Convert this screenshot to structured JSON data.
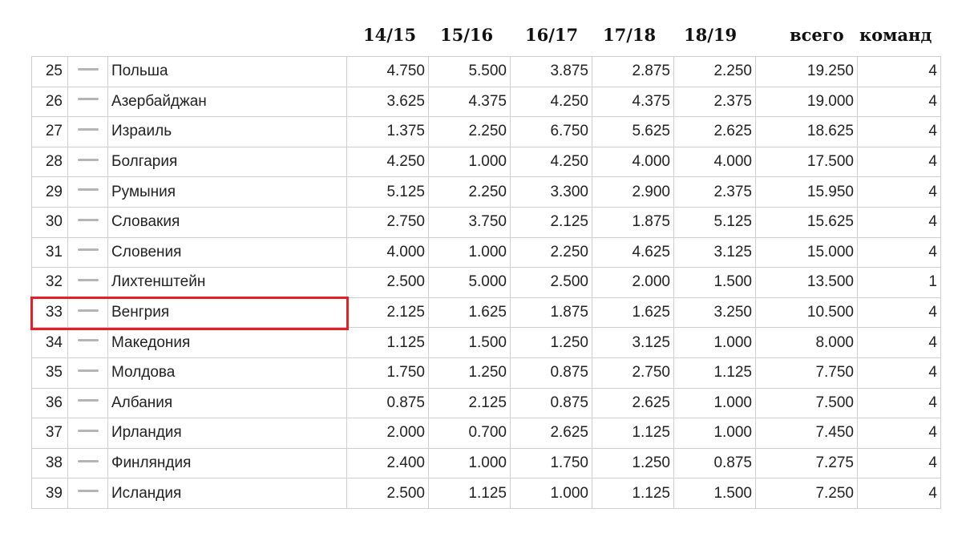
{
  "header": {
    "seasons": [
      "14/15",
      "15/16",
      "16/17",
      "17/18",
      "18/19"
    ],
    "total_label": "всего",
    "teams_label": "команд"
  },
  "rows": [
    {
      "rank": "25",
      "country": "Польша",
      "s1": "4.750",
      "s2": "5.500",
      "s3": "3.875",
      "s4": "2.875",
      "s5": "2.250",
      "total": "19.250",
      "teams": "4"
    },
    {
      "rank": "26",
      "country": "Азербайджан",
      "s1": "3.625",
      "s2": "4.375",
      "s3": "4.250",
      "s4": "4.375",
      "s5": "2.375",
      "total": "19.000",
      "teams": "4"
    },
    {
      "rank": "27",
      "country": "Израиль",
      "s1": "1.375",
      "s2": "2.250",
      "s3": "6.750",
      "s4": "5.625",
      "s5": "2.625",
      "total": "18.625",
      "teams": "4"
    },
    {
      "rank": "28",
      "country": "Болгария",
      "s1": "4.250",
      "s2": "1.000",
      "s3": "4.250",
      "s4": "4.000",
      "s5": "4.000",
      "total": "17.500",
      "teams": "4"
    },
    {
      "rank": "29",
      "country": "Румыния",
      "s1": "5.125",
      "s2": "2.250",
      "s3": "3.300",
      "s4": "2.900",
      "s5": "2.375",
      "total": "15.950",
      "teams": "4"
    },
    {
      "rank": "30",
      "country": "Словакия",
      "s1": "2.750",
      "s2": "3.750",
      "s3": "2.125",
      "s4": "1.875",
      "s5": "5.125",
      "total": "15.625",
      "teams": "4"
    },
    {
      "rank": "31",
      "country": "Словения",
      "s1": "4.000",
      "s2": "1.000",
      "s3": "2.250",
      "s4": "4.625",
      "s5": "3.125",
      "total": "15.000",
      "teams": "4"
    },
    {
      "rank": "32",
      "country": "Лихтенштейн",
      "s1": "2.500",
      "s2": "5.000",
      "s3": "2.500",
      "s4": "2.000",
      "s5": "1.500",
      "total": "13.500",
      "teams": "1"
    },
    {
      "rank": "33",
      "country": "Венгрия",
      "s1": "2.125",
      "s2": "1.625",
      "s3": "1.875",
      "s4": "1.625",
      "s5": "3.250",
      "total": "10.500",
      "teams": "4",
      "highlighted": true
    },
    {
      "rank": "34",
      "country": "Македония",
      "s1": "1.125",
      "s2": "1.500",
      "s3": "1.250",
      "s4": "3.125",
      "s5": "1.000",
      "total": "8.000",
      "teams": "4"
    },
    {
      "rank": "35",
      "country": "Молдова",
      "s1": "1.750",
      "s2": "1.250",
      "s3": "0.875",
      "s4": "2.750",
      "s5": "1.125",
      "total": "7.750",
      "teams": "4"
    },
    {
      "rank": "36",
      "country": "Албания",
      "s1": "0.875",
      "s2": "2.125",
      "s3": "0.875",
      "s4": "2.625",
      "s5": "1.000",
      "total": "7.500",
      "teams": "4"
    },
    {
      "rank": "37",
      "country": "Ирландия",
      "s1": "2.000",
      "s2": "0.700",
      "s3": "2.625",
      "s4": "1.125",
      "s5": "1.000",
      "total": "7.450",
      "teams": "4"
    },
    {
      "rank": "38",
      "country": "Финляндия",
      "s1": "2.400",
      "s2": "1.000",
      "s3": "1.750",
      "s4": "1.250",
      "s5": "0.875",
      "total": "7.275",
      "teams": "4"
    },
    {
      "rank": "39",
      "country": "Исландия",
      "s1": "2.500",
      "s2": "1.125",
      "s3": "1.000",
      "s4": "1.125",
      "s5": "1.500",
      "total": "7.250",
      "teams": "4"
    }
  ],
  "colors": {
    "highlight_border": "#e41f26",
    "grid": "#cfcfcf",
    "trend_dash": "#b5b5b5"
  },
  "icons": {
    "trend": "no-change-dash-icon"
  }
}
